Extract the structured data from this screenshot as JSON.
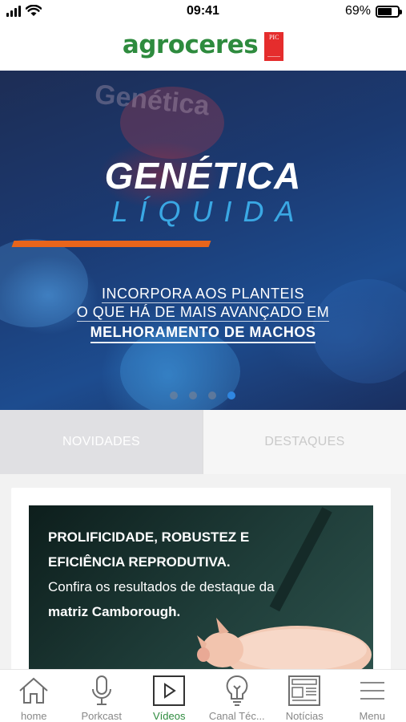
{
  "status_bar": {
    "time": "09:41",
    "battery": "69%",
    "battery_level": 0.69
  },
  "header": {
    "brand": "agroceres",
    "badge": "PIC"
  },
  "banner": {
    "bg_word": "Genética",
    "title": "GENÉTICA",
    "subtitle": "LÍQUIDA",
    "line1": "INCORPORA AOS PLANTEIS",
    "line2": "O QUE HÁ DE MAIS AVANÇADO EM",
    "line3": "MELHORAMENTO DE MACHOS",
    "dots_total": 4,
    "active_dot": 4
  },
  "tabs": [
    {
      "label": "NOVIDADES",
      "active": true
    },
    {
      "label": "DESTAQUES",
      "active": false
    }
  ],
  "card": {
    "title1": "PROLIFICIDADE, ROBUSTEZ E",
    "title2": "EFICIÊNCIA REPRODUTIVA.",
    "line3": "Confira os resultados de destaque da",
    "line4": "matriz Camborough."
  },
  "nav": {
    "items": [
      {
        "label": "home",
        "icon": "home-icon",
        "active": false
      },
      {
        "label": "Porkcast",
        "icon": "microphone-icon",
        "active": false
      },
      {
        "label": "Vídeos",
        "icon": "play-icon",
        "active": true
      },
      {
        "label": "Canal Téc...",
        "icon": "lightbulb-icon",
        "active": false
      },
      {
        "label": "Notícias",
        "icon": "newspaper-icon",
        "active": false
      },
      {
        "label": "Menu",
        "icon": "menu-icon",
        "active": false
      }
    ]
  },
  "colors": {
    "brand_green": "#2e8b3e",
    "accent_orange": "#e8651b",
    "accent_blue": "#3aa8e4",
    "active_dot": "#2f86e0"
  }
}
